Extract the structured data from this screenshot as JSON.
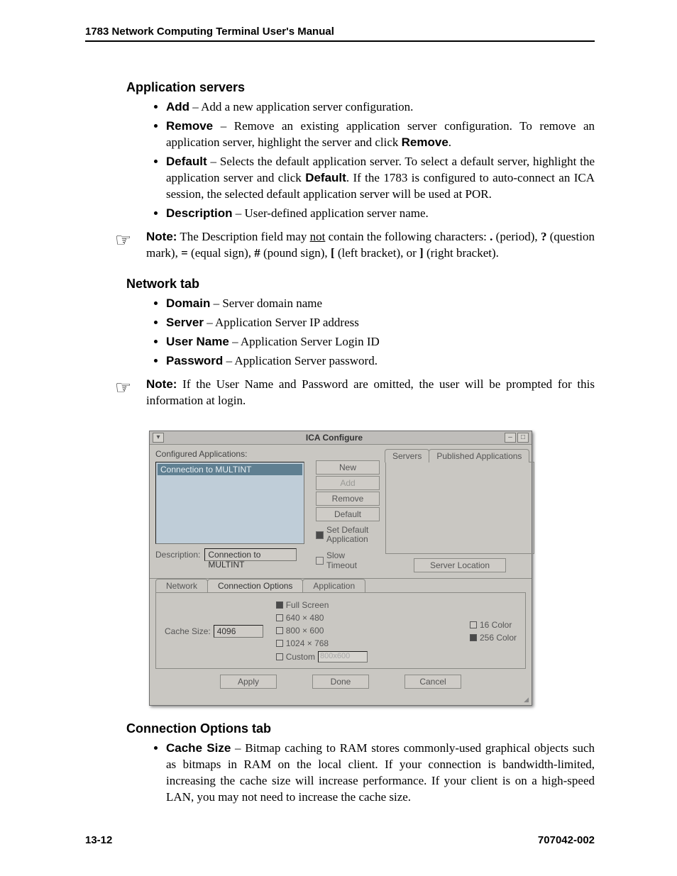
{
  "header": {
    "title": "1783 Network Computing Terminal User's Manual"
  },
  "sections": {
    "app_servers": {
      "title": "Application servers",
      "items": [
        {
          "term": "Add",
          "desc": " – Add a new application server configuration."
        },
        {
          "term": "Remove",
          "desc_a": " – Remove an existing application server configuration. To remove an application server, highlight the server and click ",
          "desc_bold": "Remove",
          "desc_b": "."
        },
        {
          "term": "Default",
          "desc_a": " – Selects the default application server. To select a default server, highlight the application server and click ",
          "desc_bold": "Default",
          "desc_b": ". If the 1783 is configured to auto-connect an ICA session, the selected default application server will be used at POR."
        },
        {
          "term": "Description",
          "desc": " – User-defined application server name."
        }
      ],
      "note": {
        "label": "Note:",
        "a": " The Description field may ",
        "u": "not",
        "b": " contain the following characters:   ",
        "p1b": ".",
        "p1": " (period),  ",
        "p2b": "?",
        "p2": " (question mark),  ",
        "p3b": "=",
        "p3": " (equal sign),  ",
        "p4b": "#",
        "p4": " (pound sign),  ",
        "p5b": "[",
        "p5": " (left bracket), or  ",
        "p6b": "]",
        "p6": " (right bracket)."
      }
    },
    "network_tab": {
      "title": "Network tab",
      "items": [
        {
          "term": "Domain",
          "desc": " – Server domain name"
        },
        {
          "term": "Server",
          "desc": " – Application Server IP address"
        },
        {
          "term": "User Name",
          "desc": " – Application Server Login ID"
        },
        {
          "term": "Password",
          "desc": " – Application Server password."
        }
      ],
      "note": {
        "label": "Note:",
        "text": " If the User Name and Password are omitted, the user will be prompted for this information at login."
      }
    },
    "conn_opts": {
      "title": "Connection Options tab",
      "item": {
        "term": "Cache Size",
        "desc": " – Bitmap caching to RAM stores commonly-used graphical objects such as bitmaps in RAM on the local client. If your connection is bandwidth-limited, increasing the cache size will increase performance. If your client is on a high-speed LAN, you may not need to increase the cache size."
      }
    }
  },
  "widget": {
    "title": "ICA Configure",
    "cfg_label": "Configured Applications:",
    "list_item": "Connection to MULTINT",
    "buttons": {
      "new": "New",
      "add": "Add",
      "remove": "Remove",
      "default": "Default"
    },
    "set_default": "Set Default Application",
    "slow_timeout": "Slow Timeout",
    "tabs_right": {
      "servers": "Servers",
      "pub": "Published Applications"
    },
    "desc_label": "Description:",
    "desc_value": "Connection to MULTINT",
    "server_location": "Server Location",
    "tabs_lower": {
      "network": "Network",
      "conn": "Connection Options",
      "app": "Application"
    },
    "cache_label": "Cache Size:",
    "cache_value": "4096",
    "res": {
      "full": "Full Screen",
      "r1": "640 × 480",
      "r2": "800 × 600",
      "r3": "1024 × 768",
      "custom": "Custom",
      "custom_val": "800x600"
    },
    "color": {
      "c16": "16 Color",
      "c256": "256 Color"
    },
    "foot": {
      "apply": "Apply",
      "done": "Done",
      "cancel": "Cancel"
    }
  },
  "footer": {
    "left": "13-12",
    "right": "707042-002"
  }
}
